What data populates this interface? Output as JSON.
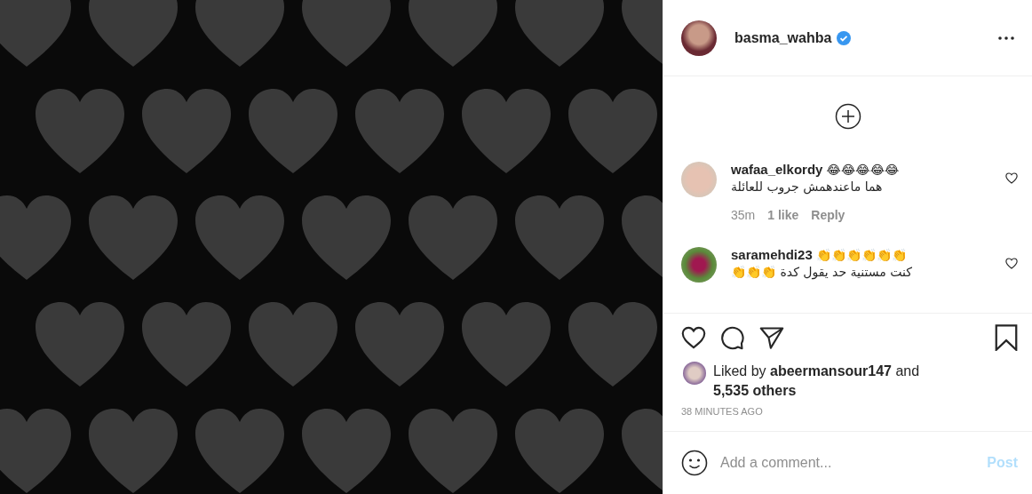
{
  "header": {
    "username": "basma_wahba",
    "verified": true
  },
  "comments": [
    {
      "username": "wafaa_elkordy",
      "emojis": "😂😂😂😂😂",
      "text": "هما ماعندهمش جروب للعائلة",
      "time": "35m",
      "likes": "1 like",
      "reply": "Reply",
      "liked": false
    },
    {
      "username": "saramehdi23",
      "emojis": "👏👏👏👏👏👏",
      "text": "كنت مستنية حد يقول كدة 👏👏👏",
      "liked": false
    }
  ],
  "actions": {
    "liked": false,
    "saved": false
  },
  "likes": {
    "prefix": "Liked by",
    "user": "abeermansour147",
    "joiner": "and",
    "others": "5,535 others"
  },
  "timestamp": "38 MINUTES AGO",
  "comment_box": {
    "placeholder": "Add a comment...",
    "post_label": "Post",
    "disabled": true
  }
}
